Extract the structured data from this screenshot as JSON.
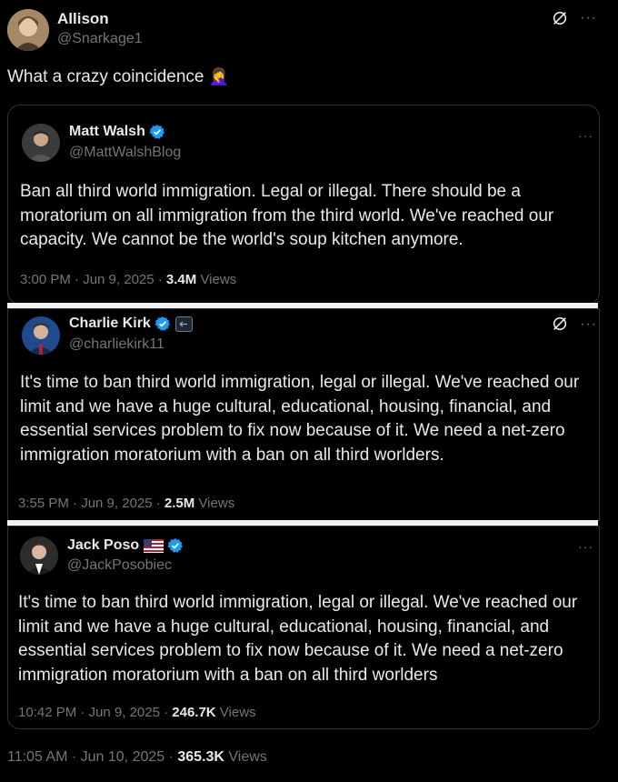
{
  "outer": {
    "author_name": "Allison",
    "author_handle": "@Snarkage1",
    "text": "What a crazy coincidence",
    "emoji": "🤦‍♀️",
    "timestamp": "11:05 AM · Jun 10, 2025 · ",
    "views_count": "365.3K",
    "views_label": " Views"
  },
  "quotes": [
    {
      "author_name": "Matt Walsh",
      "author_handle": "@MattWalshBlog",
      "text": "Ban all third world immigration. Legal or illegal. There should be a moratorium on all immigration from the third world. We've reached our capacity. We cannot be the world's soup kitchen anymore.",
      "timestamp": "3:00 PM · Jun 9, 2025 · ",
      "views_count": "3.4M",
      "views_label": " Views"
    },
    {
      "author_name": "Charlie Kirk",
      "author_handle": "@charliekirk11",
      "text": "It's time to ban third world immigration, legal or illegal. We've reached our limit and we have a huge cultural, educational, housing, financial, and essential services problem to fix now because of it. We need a net-zero immigration moratorium with a ban on all third worlders.",
      "timestamp": "3:55 PM · Jun 9, 2025 · ",
      "views_count": "2.5M",
      "views_label": " Views"
    },
    {
      "author_name": "Jack Poso",
      "author_handle": "@JackPosobiec",
      "text": "It's time to ban third world immigration, legal or illegal. We've reached our limit and we have a huge cultural, educational, housing, financial, and essential services problem to fix now because of it. We need a net-zero immigration moratorium with a ban on all third worlders",
      "timestamp": "10:42 PM · Jun 9, 2025 · ",
      "views_count": "246.7K",
      "views_label": " Views"
    }
  ],
  "icons": {
    "more": "···",
    "verified_color": "#1d9bf0"
  }
}
